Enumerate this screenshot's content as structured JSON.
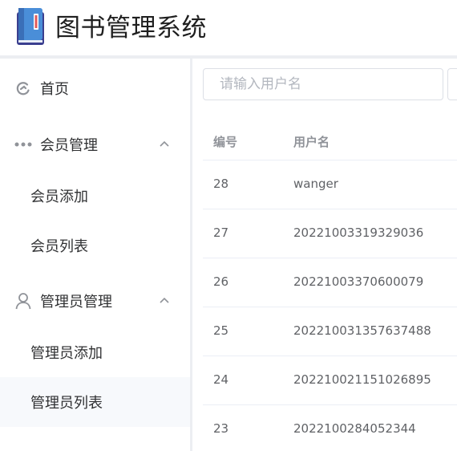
{
  "header": {
    "title": "图书管理系统",
    "logo_icon": "book-icon"
  },
  "sidebar": {
    "home": {
      "label": "首页",
      "icon": "home-icon"
    },
    "member_group": {
      "label": "会员管理",
      "icon": "more-dots-icon",
      "expanded": true,
      "items": [
        {
          "label": "会员添加"
        },
        {
          "label": "会员列表"
        }
      ]
    },
    "admin_group": {
      "label": "管理员管理",
      "icon": "user-icon",
      "expanded": true,
      "items": [
        {
          "label": "管理员添加"
        },
        {
          "label": "管理员列表",
          "active": true
        }
      ]
    }
  },
  "search": {
    "placeholder": "请输入用户名",
    "value": ""
  },
  "table": {
    "columns": [
      "编号",
      "用户名"
    ],
    "rows": [
      {
        "id": "28",
        "username": "wanger"
      },
      {
        "id": "27",
        "username": "20221003319329036"
      },
      {
        "id": "26",
        "username": "20221003370600079"
      },
      {
        "id": "25",
        "username": "202210031357637488"
      },
      {
        "id": "24",
        "username": "202210021151026895"
      },
      {
        "id": "23",
        "username": "2022100284052344"
      }
    ]
  },
  "colors": {
    "accent": "#409eff",
    "border": "#dcdfe6",
    "active_bg": "#f7f9fc"
  }
}
